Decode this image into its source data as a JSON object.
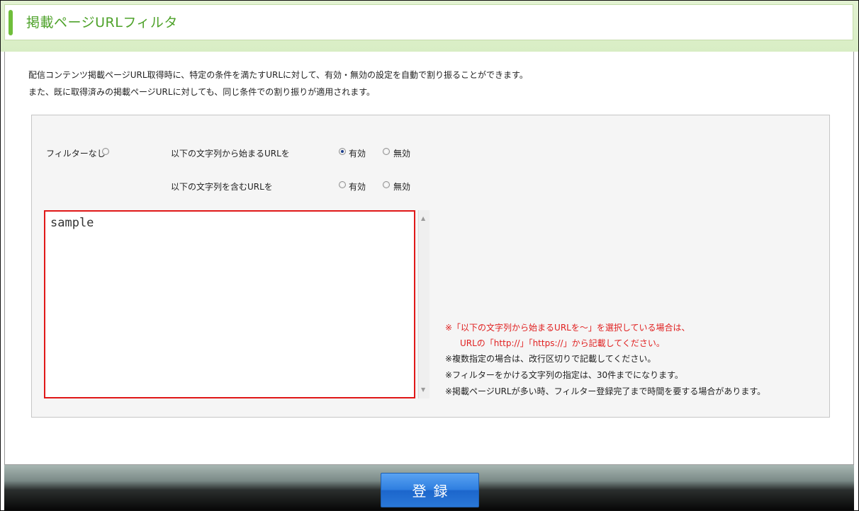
{
  "header": {
    "title": "掲載ページURLフィルタ"
  },
  "description": {
    "line1": "配信コンテンツ掲載ページURL取得時に、特定の条件を満たすURLに対して、有効・無効の設定を自動で割り振ることができます。",
    "line2": "また、既に取得済みの掲載ページURLに対しても、同じ条件での割り振りが適用されます。"
  },
  "filter": {
    "no_filter_label": "フィルターなし",
    "starts_with_label": "以下の文字列から始まるURLを",
    "contains_label": "以下の文字列を含むURLを",
    "valid_label": "有効",
    "invalid_label": "無効",
    "selected": "starts_with_valid",
    "textarea_value": "sample"
  },
  "notes": [
    "※「以下の文字列から始まるURLを～」を選択している場合は、",
    "URLの「http://」「https://」から記載してください。",
    "※複数指定の場合は、改行区切りで記載してください。",
    "※フィルターをかける文字列の指定は、30件までになります。",
    "※掲載ページURLが多い時、フィルター登録完了まで時間を要する場合があります。"
  ],
  "footer": {
    "register_label": "登録"
  },
  "colors": {
    "accent_green": "#6fbe3a",
    "note_red": "#e02020",
    "button_blue": "#2f7fe0",
    "textarea_border": "#e01818"
  }
}
